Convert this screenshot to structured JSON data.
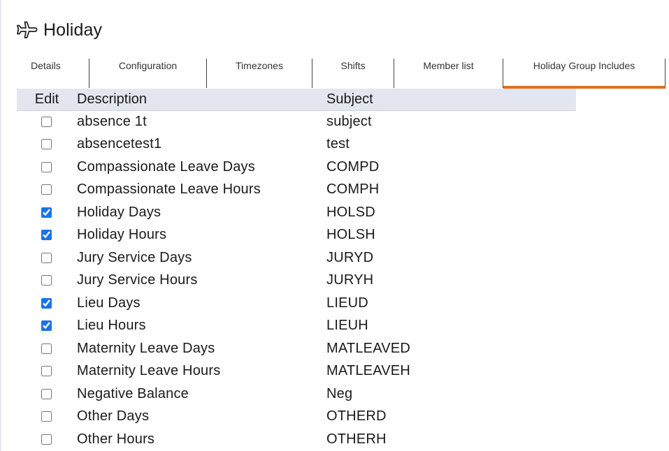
{
  "header": {
    "title": "Holiday",
    "icon": "airplane-icon"
  },
  "tabs": [
    {
      "label": "Details",
      "active": false
    },
    {
      "label": "Configuration",
      "active": false
    },
    {
      "label": "Timezones",
      "active": false
    },
    {
      "label": "Shifts",
      "active": false
    },
    {
      "label": "Member list",
      "active": false
    },
    {
      "label": "Holiday Group Includes",
      "active": true
    }
  ],
  "colors": {
    "accent": "#e0701f",
    "header_bg": "#e4e6ef",
    "checkbox": "#1a73e8"
  },
  "table": {
    "columns": {
      "edit": "Edit",
      "description": "Description",
      "subject": "Subject"
    },
    "rows": [
      {
        "checked": false,
        "description": "absence 1t",
        "subject": "subject"
      },
      {
        "checked": false,
        "description": "absencetest1",
        "subject": "test"
      },
      {
        "checked": false,
        "description": "Compassionate Leave Days",
        "subject": "COMPD"
      },
      {
        "checked": false,
        "description": "Compassionate Leave Hours",
        "subject": "COMPH"
      },
      {
        "checked": true,
        "description": "Holiday Days",
        "subject": "HOLSD"
      },
      {
        "checked": true,
        "description": "Holiday Hours",
        "subject": "HOLSH"
      },
      {
        "checked": false,
        "description": "Jury Service Days",
        "subject": "JURYD"
      },
      {
        "checked": false,
        "description": "Jury Service Hours",
        "subject": "JURYH"
      },
      {
        "checked": true,
        "description": "Lieu Days",
        "subject": "LIEUD"
      },
      {
        "checked": true,
        "description": "Lieu Hours",
        "subject": "LIEUH"
      },
      {
        "checked": false,
        "description": "Maternity Leave Days",
        "subject": "MATLEAVED"
      },
      {
        "checked": false,
        "description": "Maternity Leave Hours",
        "subject": "MATLEAVEH"
      },
      {
        "checked": false,
        "description": "Negative Balance",
        "subject": "Neg"
      },
      {
        "checked": false,
        "description": "Other Days",
        "subject": "OTHERD"
      },
      {
        "checked": false,
        "description": "Other Hours",
        "subject": "OTHERH"
      }
    ]
  }
}
